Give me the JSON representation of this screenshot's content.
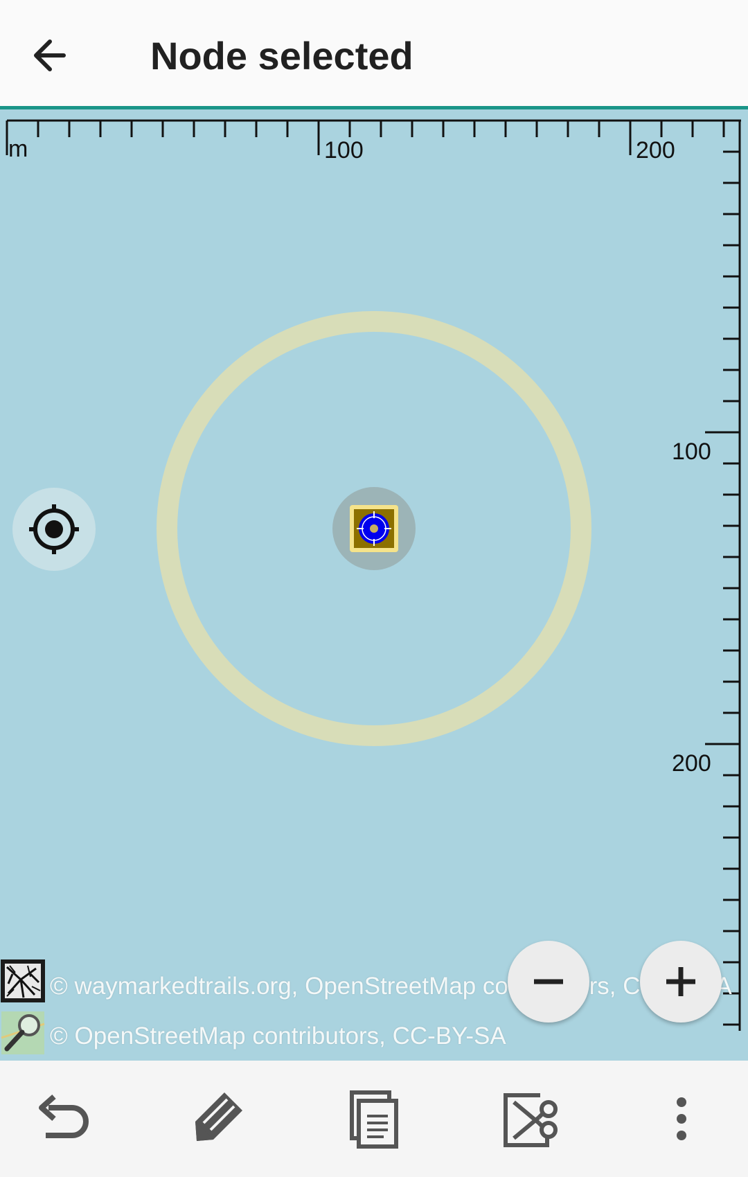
{
  "appbar": {
    "title": "Node selected",
    "back_icon": "arrow-left-icon"
  },
  "map": {
    "background_color": "#aad3df",
    "scale_unit": "m",
    "top_scale_labels": [
      "100",
      "200"
    ],
    "right_scale_labels": [
      "100",
      "200"
    ],
    "attribution_overlay": "© waymarkedtrails.org, OpenStreetMap contributors, CC-by-SA",
    "attribution_base": "© OpenStreetMap contributors, CC-BY-SA",
    "zoom_out_label": "−",
    "zoom_in_label": "+",
    "accent_color": "#1a9588",
    "node_color": "#0000ee"
  },
  "toolbar": {
    "items": [
      {
        "icon": "undo-icon"
      },
      {
        "icon": "tag-edit-icon"
      },
      {
        "icon": "copy-icon"
      },
      {
        "icon": "cut-icon"
      },
      {
        "icon": "more-vert-icon"
      }
    ]
  }
}
